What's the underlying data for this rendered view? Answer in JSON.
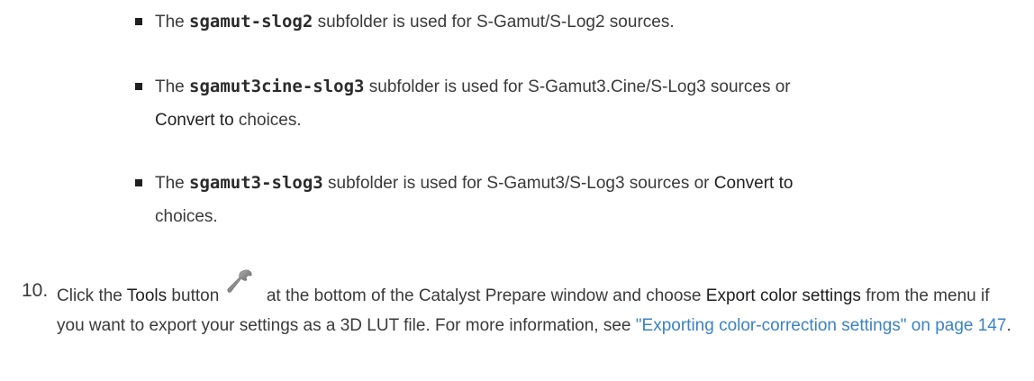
{
  "bullets": [
    {
      "prefix": "The ",
      "code": "sgamut-slog2",
      "suffix": " subfolder is used for S-Gamut/S-Log2 sources."
    },
    {
      "prefix": "The ",
      "code": "sgamut3cine-slog3",
      "middle": " subfolder is used for S-Gamut3.Cine/S-Log3 sources or ",
      "ui_term": "Convert to",
      "suffix": " choices."
    },
    {
      "prefix": "The ",
      "code": "sgamut3-slog3",
      "middle": " subfolder is used for S-Gamut3/S-Log3 sources or ",
      "ui_term": "Convert to",
      "suffix": " choices."
    }
  ],
  "step": {
    "number": "10.",
    "intro": "Click the ",
    "tools_label": "Tools",
    "after_tools": " button ",
    "icon": "wrench-icon",
    "middle": " at the bottom of the Catalyst Prepare window and choose ",
    "export_label": "Export color settings",
    "after_export": " from the menu if you want to export your settings as a 3D LUT file. For more information, see ",
    "link_text": "\"Exporting color-correction settings\" on page 147",
    "end": "."
  },
  "colors": {
    "text": "#3a3a3a",
    "link": "#3b82c4",
    "bullet": "#1f1f1f"
  }
}
